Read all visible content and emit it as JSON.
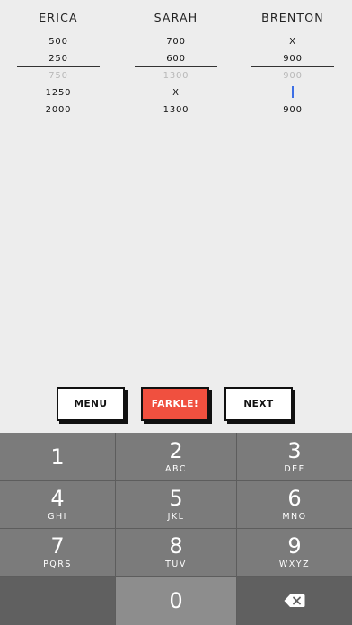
{
  "scoreboard": {
    "players": [
      {
        "name": "ERICA",
        "rows": [
          "500",
          "250",
          "750",
          "1250",
          "2000"
        ]
      },
      {
        "name": "SARAH",
        "rows": [
          "700",
          "600",
          "1300",
          "X",
          "1300"
        ]
      },
      {
        "name": "BRENTON",
        "rows": [
          "X",
          "900",
          "900",
          "",
          "900"
        ]
      }
    ]
  },
  "actions": {
    "menu_label": "MENU",
    "farkle_label": "FARKLE!",
    "next_label": "NEXT"
  },
  "keypad": {
    "keys": [
      {
        "num": "1",
        "letters": ""
      },
      {
        "num": "2",
        "letters": "ABC"
      },
      {
        "num": "3",
        "letters": "DEF"
      },
      {
        "num": "4",
        "letters": "GHI"
      },
      {
        "num": "5",
        "letters": "JKL"
      },
      {
        "num": "6",
        "letters": "MNO"
      },
      {
        "num": "7",
        "letters": "PQRS"
      },
      {
        "num": "8",
        "letters": "TUV"
      },
      {
        "num": "9",
        "letters": "WXYZ"
      },
      {
        "num": "0",
        "letters": ""
      }
    ],
    "backspace_icon": "backspace-icon"
  },
  "colors": {
    "background": "#ededed",
    "farkle_accent": "#f0503f",
    "caret": "#3d6fe5",
    "keypad_key": "#7b7b7b",
    "keypad_dark": "#5d5d5d"
  }
}
